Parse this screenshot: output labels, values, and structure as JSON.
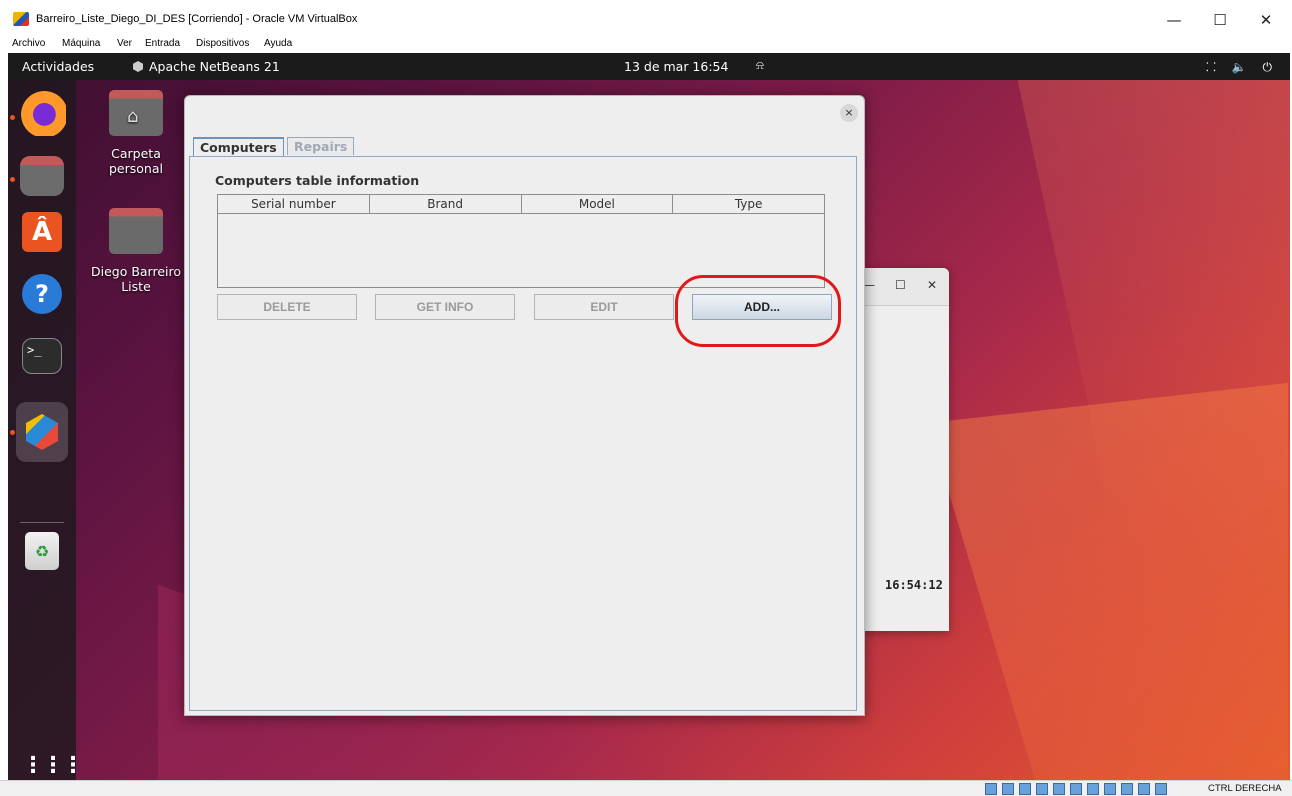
{
  "host": {
    "window_title": "Barreiro_Liste_Diego_DI_DES [Corriendo] - Oracle VM VirtualBox",
    "menu": [
      "Archivo",
      "Máquina",
      "Ver",
      "Entrada",
      "Dispositivos",
      "Ayuda"
    ],
    "controls": {
      "minimize": "—",
      "maximize": "☐",
      "close": "✕"
    },
    "statusbar": {
      "host_key": "CTRL DERECHA"
    }
  },
  "guest": {
    "topbar": {
      "activities": "Actividades",
      "app": "Apache NetBeans 21",
      "clock": "13 de mar  16:54",
      "bell_icon": "alarm-icon",
      "tray": "⸬ 🔈 ⏻"
    },
    "desktop": [
      {
        "label": "Carpeta personal",
        "icon": "home-folder-icon"
      },
      {
        "label": "Diego Barreiro Liste",
        "icon": "folder-icon"
      }
    ],
    "dock": [
      "firefox",
      "files",
      "app-center",
      "help",
      "terminal",
      "netbeans",
      "trash",
      "show-apps"
    ]
  },
  "dialog": {
    "close": "×",
    "tabs": [
      "Computers",
      "Repairs"
    ],
    "active_tab": "Computers",
    "panel_title": "Computers table information",
    "table": {
      "columns": [
        "Serial number",
        "Brand",
        "Model",
        "Type"
      ],
      "rows": []
    },
    "buttons": {
      "delete": "DELETE",
      "get_info": "GET INFO",
      "edit": "EDIT",
      "add": "ADD..."
    }
  },
  "background_window": {
    "minimize": "—",
    "maximize": "☐",
    "close": "✕",
    "time": "16:54:12"
  },
  "colors": {
    "highlight": "#e01818",
    "ubuntu_orange": "#e95420"
  }
}
